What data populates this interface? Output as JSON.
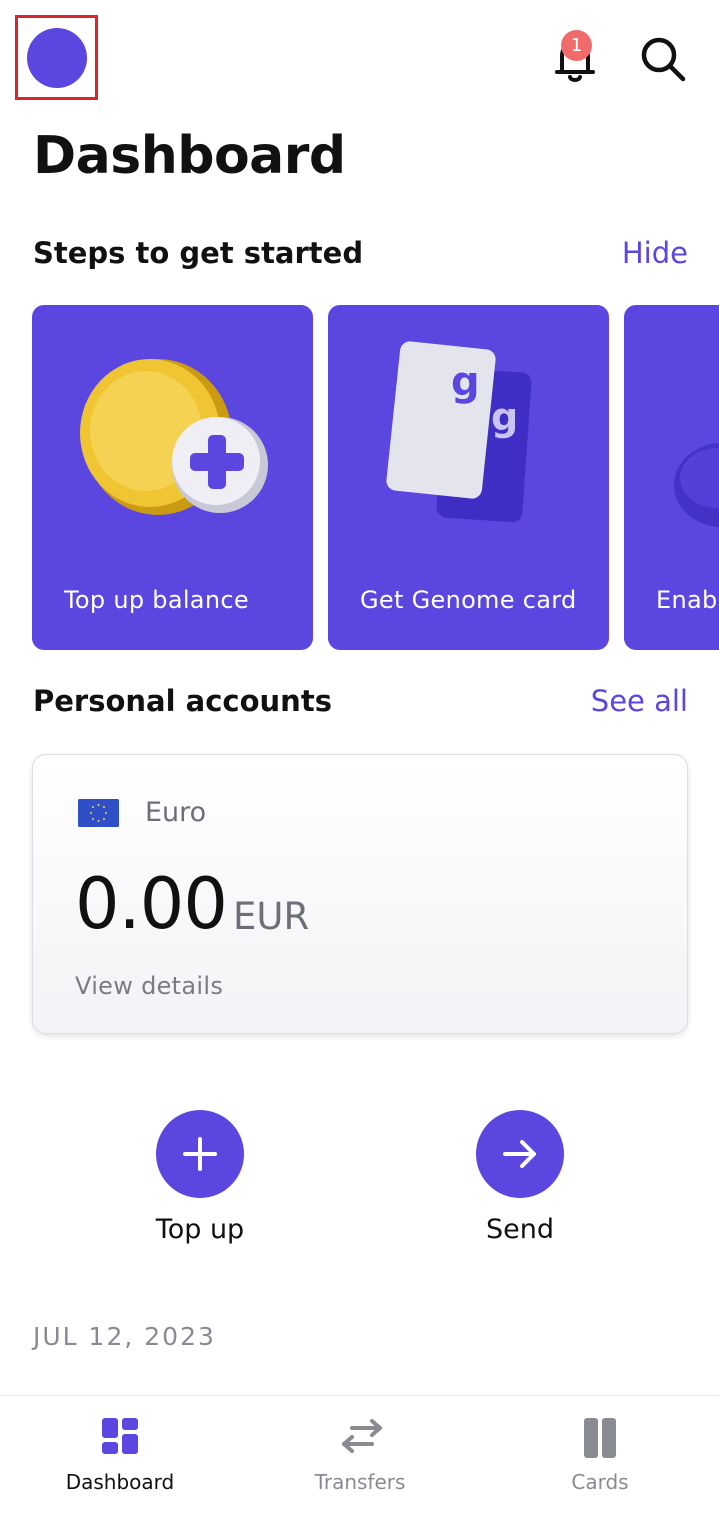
{
  "header": {
    "notification_count": "1",
    "icons": [
      "avatar",
      "bell-icon",
      "search-icon"
    ]
  },
  "page_title": "Dashboard",
  "steps_section": {
    "title": "Steps to get started",
    "action": "Hide",
    "cards": [
      {
        "label": "Top up balance",
        "icon": "coin-plus-icon"
      },
      {
        "label": "Get Genome card",
        "icon": "cards-icon"
      },
      {
        "label": "Enab",
        "icon": "sphere-icon"
      }
    ]
  },
  "accounts_section": {
    "title": "Personal accounts",
    "action": "See all",
    "account": {
      "name": "Euro",
      "balance": "0.00",
      "currency": "EUR",
      "details_link": "View details"
    }
  },
  "actions": [
    {
      "label": "Top up",
      "icon": "plus-icon"
    },
    {
      "label": "Send",
      "icon": "arrow-right-icon"
    }
  ],
  "date_header": "JUL 12, 2023",
  "bottom_nav": [
    {
      "label": "Dashboard",
      "icon": "grid-icon",
      "active": true
    },
    {
      "label": "Transfers",
      "icon": "swap-icon",
      "active": false
    },
    {
      "label": "Cards",
      "icon": "cards-nav-icon",
      "active": false
    }
  ],
  "colors": {
    "accent": "#5b46e0",
    "badge": "#f26b6b",
    "muted_text": "#8a8a93",
    "highlight_frame": "#d9262c"
  }
}
